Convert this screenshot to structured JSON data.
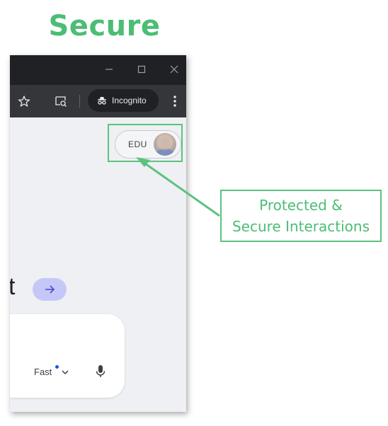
{
  "heading": "Secure",
  "browser": {
    "window_controls": {
      "minimize_icon": "minimize-icon",
      "maximize_icon": "maximize-icon",
      "close_icon": "close-icon"
    },
    "toolbar": {
      "bookmark_icon": "star-icon",
      "lens_icon": "search-page-icon",
      "incognito_label": "Incognito",
      "menu_icon": "more-vert-icon"
    },
    "content": {
      "profile_badge_text": "EDU",
      "heading_fragment": "t",
      "go_icon": "arrow-right-icon",
      "mode_selector_label": "Fast",
      "mic_icon": "mic-icon"
    }
  },
  "callout": {
    "line1": "Protected &",
    "line2": "Secure Interactions"
  },
  "colors": {
    "accent_green": "#4cbd74",
    "browser_titlebar": "#202124",
    "browser_toolbar": "#35363a",
    "go_button": "#c5c8f7"
  }
}
